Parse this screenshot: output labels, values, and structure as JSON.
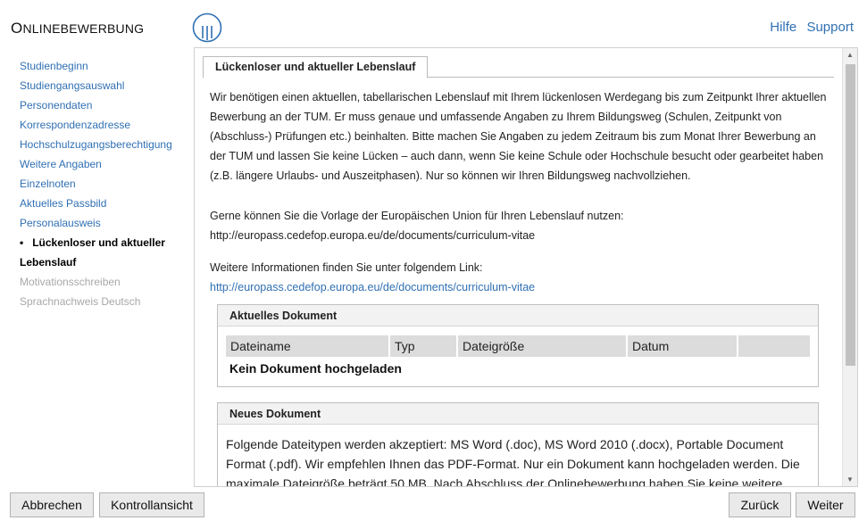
{
  "header": {
    "brand_first": "O",
    "brand_rest": "NLINEBEWERBUNG",
    "links": [
      "Hilfe",
      "Support"
    ]
  },
  "sidebar": {
    "items": [
      {
        "label": "Studienbeginn"
      },
      {
        "label": "Studiengangsauswahl"
      },
      {
        "label": "Personendaten"
      },
      {
        "label": "Korrespondenzadresse"
      },
      {
        "label": "Hochschulzugangsberechtigung"
      },
      {
        "label": "Weitere Angaben"
      },
      {
        "label": "Einzelnoten"
      },
      {
        "label": "Aktuelles Passbild"
      },
      {
        "label": "Personalausweis"
      },
      {
        "label": "Lückenloser und aktueller"
      },
      {
        "label": "Lebenslauf"
      },
      {
        "label": "Motivationsschreiben"
      },
      {
        "label": "Sprachnachweis Deutsch"
      }
    ],
    "bullet": "•"
  },
  "main": {
    "tab_label": "Lückenloser und aktueller Lebenslauf",
    "intro": "Wir benötigen einen aktuellen, tabellarischen Lebenslauf mit Ihrem lückenlosen Werdegang bis zum Zeitpunkt Ihrer aktuellen Bewerbung an der TUM. Er muss genaue und umfassende Angaben zu Ihrem Bildungsweg (Schulen, Zeitpunkt von (Abschluss-) Prüfungen etc.) beinhalten. Bitte machen Sie Angaben zu jedem Zeitraum bis zum Monat Ihrer Bewerbung an der TUM und lassen Sie keine Lücken – auch dann, wenn Sie keine Schule oder Hochschule besucht oder gearbeitet haben (z.B. längere Urlaubs- und Auszeitphasen). Nur so können wir Ihren Bildungsweg nachvollziehen.",
    "template_text": "Gerne können Sie die Vorlage der Europäischen Union für Ihren Lebenslauf nutzen:",
    "template_url": "http://europass.cedefop.europa.eu/de/documents/curriculum-vitae",
    "info_text": "Weitere Informationen finden Sie unter folgendem Link:",
    "info_link": "http://europass.cedefop.europa.eu/de/documents/curriculum-vitae",
    "current_doc": {
      "title": "Aktuelles Dokument",
      "columns": [
        "Dateiname",
        "Typ",
        "Dateigröße",
        "Datum",
        ""
      ],
      "empty": "Kein Dokument hochgeladen"
    },
    "new_doc": {
      "title": "Neues Dokument",
      "text": "Folgende Dateitypen werden akzeptiert: MS Word (.doc), MS Word 2010 (.docx), Portable Document Format (.pdf). Wir empfehlen Ihnen das PDF-Format. Nur ein Dokument kann hochgeladen werden. Die maximale Dateigröße beträgt 50 MB. Nach Abschluss der Onlinebewerbung haben Sie keine weitere"
    }
  },
  "footer": {
    "cancel": "Abbrechen",
    "review": "Kontrollansicht",
    "back": "Zurück",
    "next": "Weiter"
  }
}
